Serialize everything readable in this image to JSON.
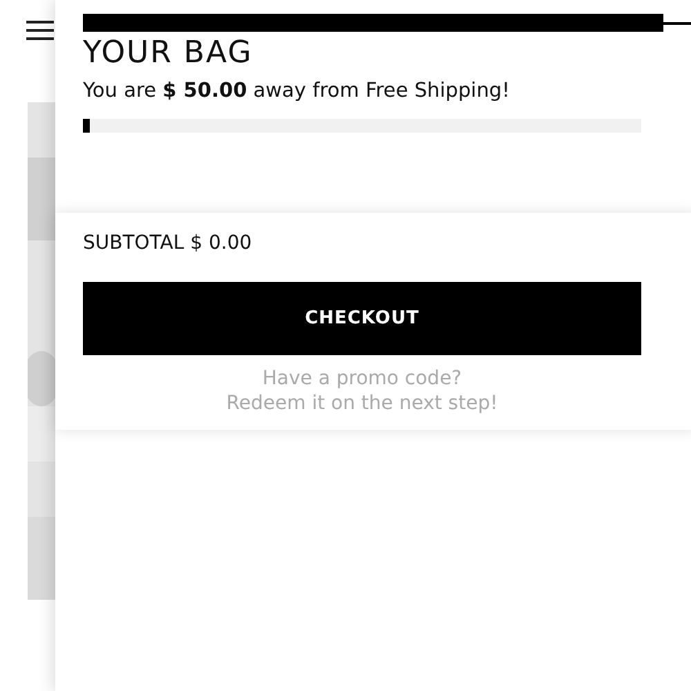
{
  "bag": {
    "title": "YOUR BAG",
    "shipping_message": "You are **$ 50.00** away from Free Shipping!",
    "shipping_progress": {
      "level": 0.012
    }
  },
  "footer": {
    "subtotal": "SUBTOTAL $ 0.00",
    "checkout_button": "CHECKOUT",
    "promo_lines": [
      "Have a promo code?",
      "Redeem it on the next step!"
    ]
  }
}
